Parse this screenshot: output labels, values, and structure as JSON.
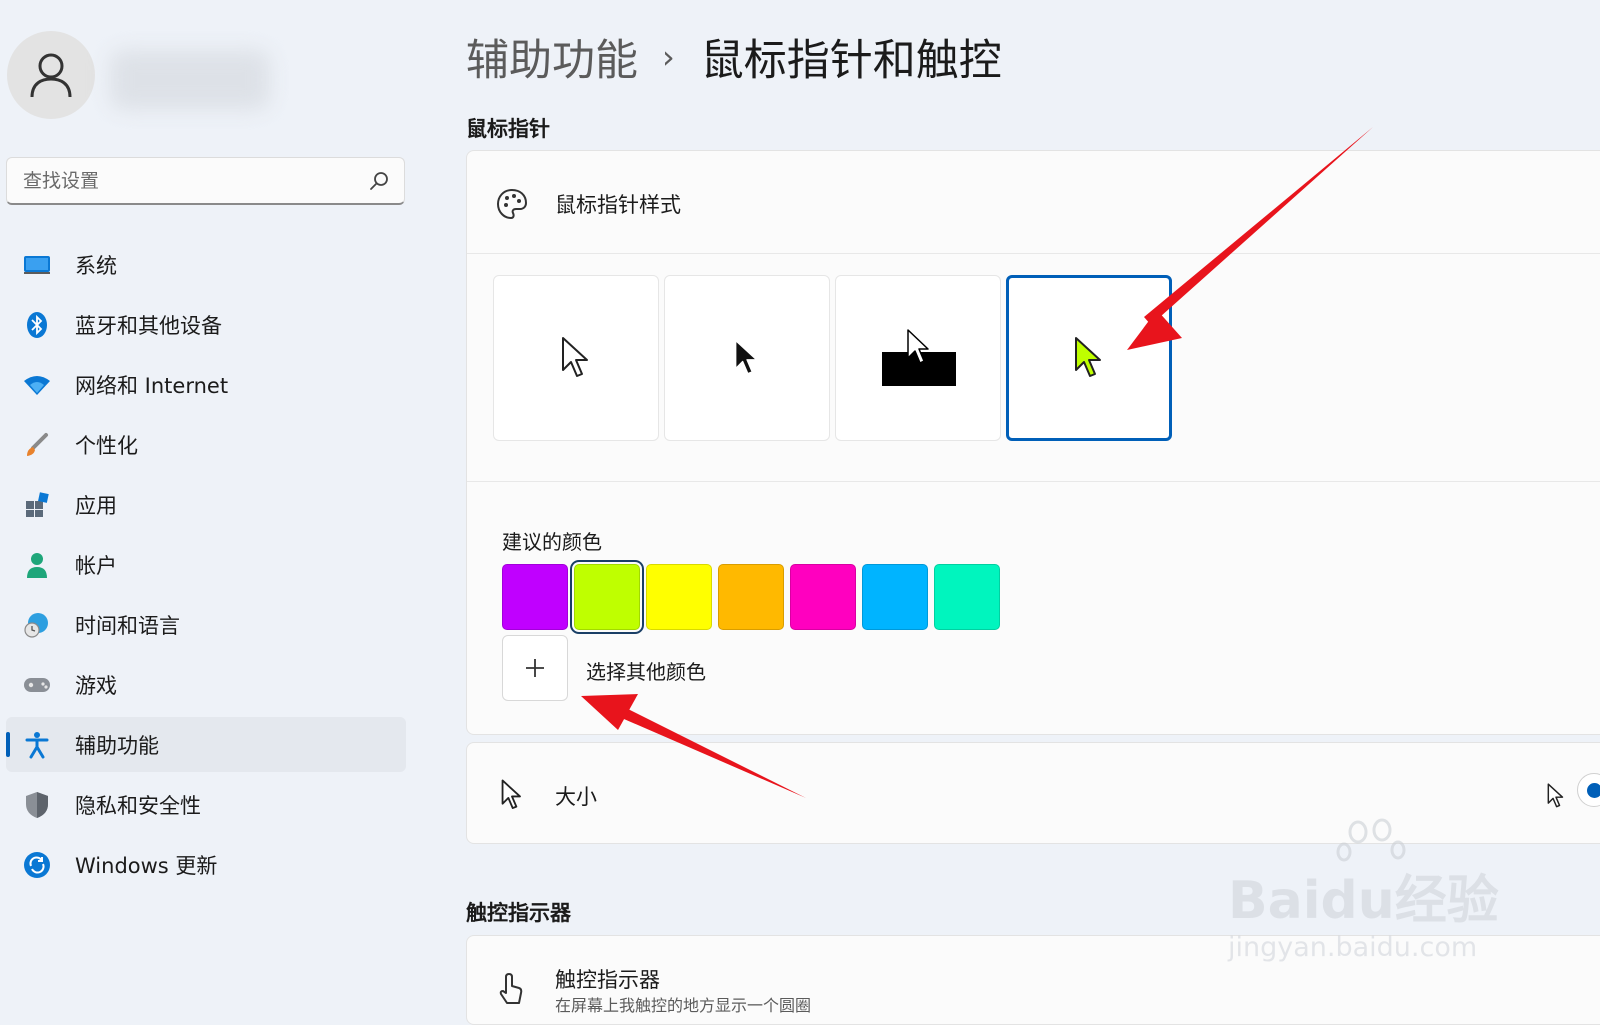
{
  "sidebar": {
    "search_placeholder": "查找设置",
    "items": [
      {
        "label": "系统",
        "icon": "monitor-icon"
      },
      {
        "label": "蓝牙和其他设备",
        "icon": "bluetooth-icon"
      },
      {
        "label": "网络和 Internet",
        "icon": "wifi-icon"
      },
      {
        "label": "个性化",
        "icon": "brush-icon"
      },
      {
        "label": "应用",
        "icon": "apps-icon"
      },
      {
        "label": "帐户",
        "icon": "person-icon"
      },
      {
        "label": "时间和语言",
        "icon": "globe-clock-icon"
      },
      {
        "label": "游戏",
        "icon": "gamepad-icon"
      },
      {
        "label": "辅助功能",
        "icon": "accessibility-icon",
        "active": true
      },
      {
        "label": "隐私和安全性",
        "icon": "shield-icon"
      },
      {
        "label": "Windows 更新",
        "icon": "update-icon"
      }
    ]
  },
  "header": {
    "parent": "辅助功能",
    "separator": "›",
    "current": "鼠标指针和触控"
  },
  "mouse_pointer": {
    "section_title": "鼠标指针",
    "style_label": "鼠标指针样式",
    "styles": [
      {
        "name": "white",
        "selected": false
      },
      {
        "name": "black",
        "selected": false
      },
      {
        "name": "inverted",
        "selected": false
      },
      {
        "name": "custom",
        "selected": true
      }
    ],
    "suggested_colors_label": "建议的颜色",
    "colors": [
      "#c000ff",
      "#bfff00",
      "#ffff00",
      "#ffb900",
      "#ff00bf",
      "#00b4ff",
      "#00f5be"
    ],
    "selected_color": "#bfff00",
    "other_color_label": "选择其他颜色",
    "size_label": "大小"
  },
  "touch_indicator": {
    "section_title": "触控指示器",
    "label": "触控指示器",
    "description": "在屏幕上我触控的地方显示一个圆圈"
  },
  "watermark": {
    "brand": "Baidu经验",
    "url": "jingyan.baidu.com"
  },
  "colors": {
    "accent": "#005fb8",
    "annotation_arrow": "#e8141c",
    "background": "#eef2f8",
    "card": "#fbfbfb"
  }
}
